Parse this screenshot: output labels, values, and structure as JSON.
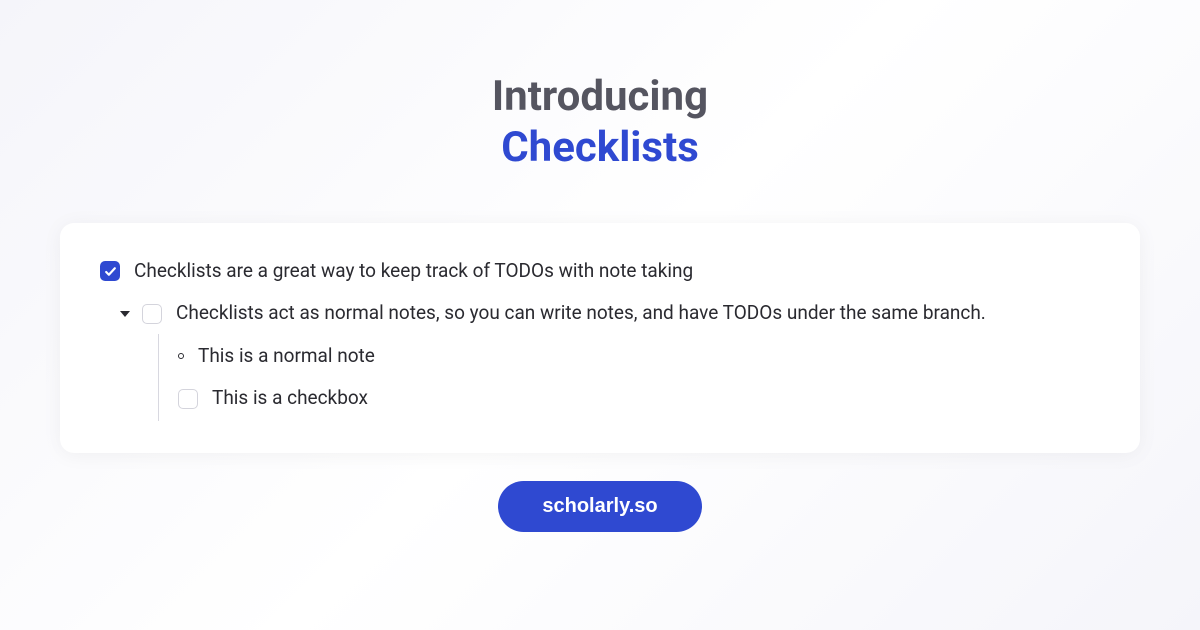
{
  "heading": {
    "line1": "Introducing",
    "line2": "Checklists"
  },
  "card": {
    "rows": [
      {
        "text": "Checklists are a great way to keep track of TODOs with note taking"
      },
      {
        "text": "Checklists act as normal notes, so you can write notes, and have TODOs under the same branch."
      },
      {
        "text": "This is a normal note"
      },
      {
        "text": "This is a checkbox"
      }
    ]
  },
  "pill": {
    "label": "scholarly.so"
  }
}
